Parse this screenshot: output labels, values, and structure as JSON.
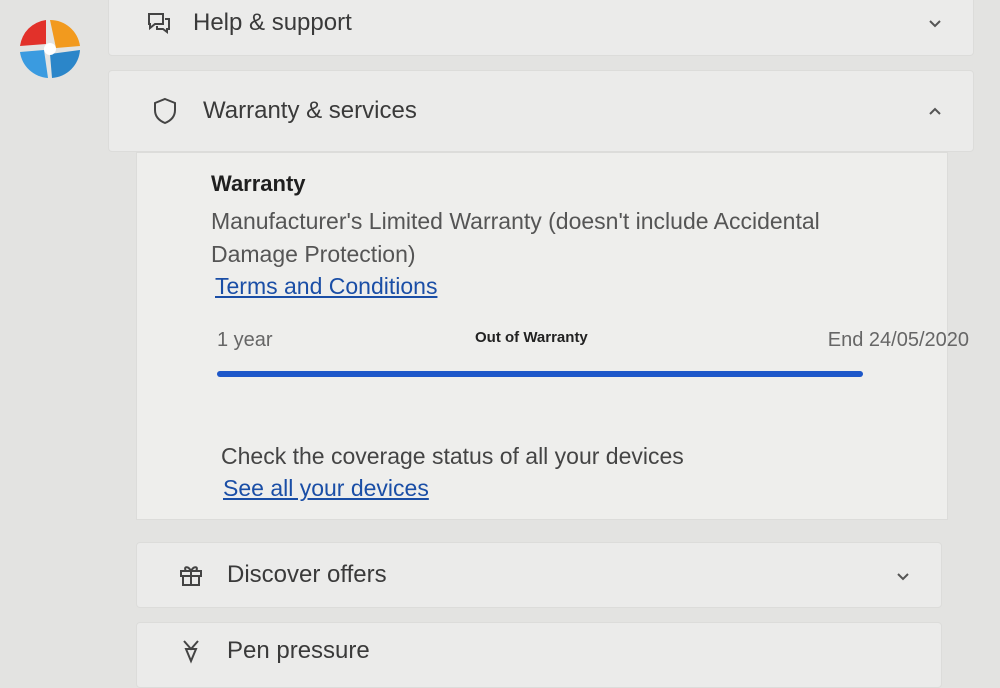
{
  "logo": {
    "name": "colorful-swirl-logo"
  },
  "sections": {
    "help": {
      "label": "Help & support",
      "icon": "chat-icon"
    },
    "warranty": {
      "label": "Warranty & services",
      "icon": "shield-icon"
    },
    "offers": {
      "label": "Discover offers",
      "icon": "gift-icon"
    },
    "pen": {
      "label": "Pen pressure",
      "icon": "pen-icon"
    }
  },
  "warranty_card": {
    "title": "Warranty",
    "description": "Manufacturer's Limited Warranty (doesn't include Accidental Damage Protection)",
    "terms_link": "Terms and Conditions",
    "duration": "1 year",
    "status": "Out of Warranty",
    "end_date": "End 24/05/2020",
    "progress": 1.0,
    "coverage_text": "Check the coverage status of all your devices",
    "devices_link": "See all your devices"
  },
  "colors": {
    "progress": "#1d57c9",
    "link": "#1a4ea6"
  }
}
